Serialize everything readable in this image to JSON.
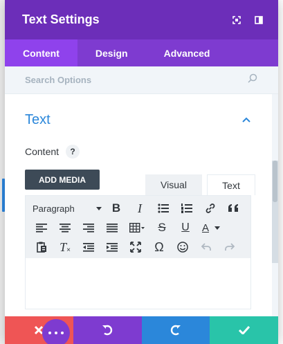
{
  "modal": {
    "title": "Text Settings",
    "header_icons": [
      "expand-icon",
      "sidebar-layout-icon"
    ]
  },
  "tabs": [
    {
      "label": "Content",
      "active": true
    },
    {
      "label": "Design",
      "active": false
    },
    {
      "label": "Advanced",
      "active": false
    }
  ],
  "search": {
    "placeholder": "Search Options"
  },
  "section": {
    "title": "Text",
    "field_label": "Content",
    "help": "?",
    "add_media_label": "ADD MEDIA",
    "editor_modes": [
      {
        "label": "Visual",
        "active": true
      },
      {
        "label": "Text",
        "active": false
      }
    ]
  },
  "toolbar": {
    "format_select": "Paragraph",
    "row1": [
      "bold-icon",
      "italic-icon",
      "bullet-list-icon",
      "numbered-list-icon",
      "link-icon",
      "blockquote-icon"
    ],
    "row2": [
      "align-left-icon",
      "align-center-icon",
      "align-right-icon",
      "justify-icon",
      "table-icon",
      "strikethrough-icon",
      "underline-icon",
      "text-color-icon"
    ],
    "row3": [
      "paste-text-icon",
      "clear-format-icon",
      "outdent-icon",
      "indent-icon",
      "fullscreen-icon",
      "omega-icon",
      "emoji-icon",
      "undo-icon",
      "redo-icon"
    ],
    "labels": {
      "bold": "B",
      "italic": "I",
      "strike": "S",
      "underline": "U",
      "color": "A",
      "omega": "Ω",
      "clear": "T"
    }
  },
  "footer": {
    "buttons": [
      "cancel",
      "undo",
      "redo",
      "save"
    ],
    "colors": {
      "cancel": "#ef5555",
      "undo": "#7e3bd0",
      "redo": "#2b87da",
      "save": "#29c4a9"
    }
  },
  "colors": {
    "header": "#6c2eb9",
    "tabs": "#7e3bd0",
    "active_tab": "#8f42ec",
    "section_title": "#2b87da"
  }
}
